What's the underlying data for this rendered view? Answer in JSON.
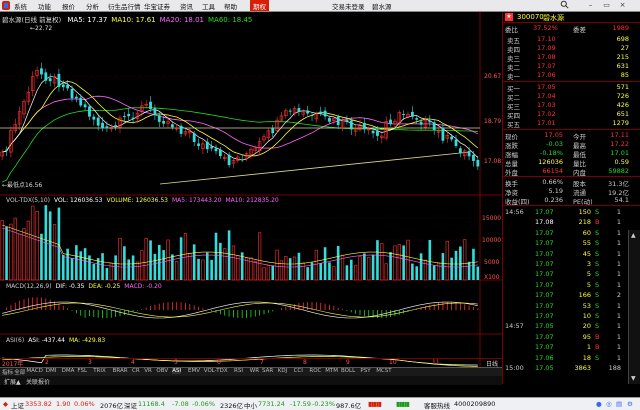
{
  "menubar": {
    "items": [
      "系统",
      "功能",
      "报价",
      "分析",
      "衍生品行情",
      "华宝证券",
      "资讯",
      "工具",
      "帮助"
    ],
    "trade": "期权",
    "center": [
      "交易未登录",
      "碧水源"
    ],
    "icons": [
      "search-icon",
      "window-min-icon",
      "window-max-icon",
      "window-close-icon"
    ]
  },
  "chart": {
    "title_stock": "碧水源(日线 前复权)",
    "ma_labels": [
      {
        "t": "MA5: 17.37",
        "c": "#ffffff"
      },
      {
        "t": "MA10: 17.61",
        "c": "#ffff33"
      },
      {
        "t": "MA20: 18.01",
        "c": "#ff66ff"
      },
      {
        "t": "MA60: 18.45",
        "c": "#22dd22"
      }
    ],
    "price_ticks": [
      "20.67",
      "18.79",
      "17.08"
    ],
    "hi_label": "22.72",
    "lo_label": "最低点16.56",
    "vol_header": [
      {
        "t": "VOL-TDX(5,10)",
        "c": "#cccccc"
      },
      {
        "t": "VOL: 126036.53",
        "c": "#ffffff"
      },
      {
        "t": "VOLUME: 126036.53",
        "c": "#ffff33"
      },
      {
        "t": "MA5: 173443.20",
        "c": "#ff66ff"
      },
      {
        "t": "MA10: 212835.20",
        "c": "#ff66ff"
      }
    ],
    "vol_ticks": [
      "15000",
      "10000",
      "5000",
      "X100"
    ],
    "macd_header": [
      {
        "t": "MACD(12,26,9)",
        "c": "#cccccc"
      },
      {
        "t": "DIF: -0.35",
        "c": "#ffffff"
      },
      {
        "t": "DEA: -0.25",
        "c": "#ffff33"
      },
      {
        "t": "MACD: -0.20",
        "c": "#ff66ff"
      }
    ],
    "asi_header": [
      {
        "t": "ASI(6)",
        "c": "#cccccc"
      },
      {
        "t": "ASI: -437.44",
        "c": "#ffffff"
      },
      {
        "t": "MA: -429.83",
        "c": "#ffff33"
      }
    ],
    "date_labels": [
      "2017年",
      "2",
      "3",
      "4",
      "5",
      "6",
      "7",
      "8",
      "9",
      "10",
      "11"
    ],
    "date_right": "日线",
    "tabs": [
      "指标",
      "全部",
      "MACD",
      "DMI",
      "DMA",
      "FSL",
      "TRIX",
      "BRAR",
      "CR",
      "VR",
      "OBV",
      "ASI",
      "EMV",
      "VOL-TDX",
      "RSI",
      "WR",
      "SAR",
      "KDJ",
      "CCI",
      "ROC",
      "MTM",
      "BOLL",
      "PSY",
      "MCST"
    ],
    "ext_tabs": [
      "扩展▲",
      "关联报价"
    ]
  },
  "quote": {
    "code": "300070",
    "name": "碧水源",
    "webi_label": "委比",
    "webi": "37.52%",
    "weicha_label": "委差",
    "weicha": "1989",
    "sells": [
      {
        "l": "卖五",
        "p": "17.10",
        "v": "698"
      },
      {
        "l": "卖四",
        "p": "17.09",
        "v": "27"
      },
      {
        "l": "卖三",
        "p": "17.08",
        "v": "215"
      },
      {
        "l": "卖二",
        "p": "17.07",
        "v": "631"
      },
      {
        "l": "卖一",
        "p": "17.06",
        "v": "85"
      }
    ],
    "buys": [
      {
        "l": "买一",
        "p": "17.05",
        "v": "571"
      },
      {
        "l": "买二",
        "p": "17.04",
        "v": "726"
      },
      {
        "l": "买三",
        "p": "17.03",
        "v": "426"
      },
      {
        "l": "买四",
        "p": "17.02",
        "v": "651"
      },
      {
        "l": "买五",
        "p": "17.01",
        "v": "1279"
      }
    ],
    "stats": [
      [
        "现价",
        "17.05",
        "今开",
        "17.11"
      ],
      [
        "涨跌",
        "-0.03",
        "最高",
        "17.22"
      ],
      [
        "涨幅",
        "-0.18%",
        "最低",
        "17.01"
      ],
      [
        "总量",
        "126036",
        "量比",
        "0.59"
      ],
      [
        "外盘",
        "66154",
        "内盘",
        "59882"
      ],
      [
        "换手",
        "0.66%",
        "股本",
        "31.3亿"
      ],
      [
        "净资",
        "5.19",
        "流通",
        "19.2亿"
      ],
      [
        "收益(四)",
        "0.236",
        "PE(动)",
        "54.1"
      ]
    ],
    "ticks": [
      [
        "14:56",
        "17.07",
        "150",
        "S",
        "1"
      ],
      [
        "",
        "17.08",
        "218",
        "B",
        "1"
      ],
      [
        "",
        "17.07",
        "60",
        "S",
        "1"
      ],
      [
        "",
        "17.07",
        "55",
        "S",
        "1"
      ],
      [
        "",
        "17.07",
        "45",
        "S",
        "1"
      ],
      [
        "",
        "17.07",
        "3",
        "S",
        "1"
      ],
      [
        "",
        "17.07",
        "5",
        "S",
        "1"
      ],
      [
        "",
        "17.07",
        "5",
        "S",
        "1"
      ],
      [
        "",
        "17.07",
        "166",
        "S",
        "2"
      ],
      [
        "",
        "17.07",
        "53",
        "S",
        "1"
      ],
      [
        "",
        "17.07",
        "10",
        "S",
        "1"
      ],
      [
        "14:57",
        "17.05",
        "20",
        "S",
        "1"
      ],
      [
        "",
        "17.07",
        "95",
        "B",
        "1"
      ],
      [
        "",
        "17.07",
        "1",
        "B",
        "1"
      ],
      [
        "",
        "17.06",
        "18",
        "S",
        "1"
      ],
      [
        "15:00",
        "17.05",
        "3863",
        "",
        "188"
      ]
    ]
  },
  "status": {
    "sh_label": "上证",
    "sh": "3353.82",
    "sh_chg": "1.90",
    "sh_pct": "0.06%",
    "sh_amt": "2076亿",
    "sz_label": "深证",
    "sz": "11168.4",
    "sz_chg": "-7.08",
    "sz_pct": "-0.06%",
    "sz_amt": "2326亿",
    "zx_label": "中小",
    "zx": "7731.24",
    "zx_chg": "-17.59",
    "zx_pct": "-0.23%",
    "zx_amt": "987.6亿",
    "hot": "客服热线",
    "phone": "4000209890"
  },
  "colors": {
    "up": "#ff3333",
    "down": "#22dd22",
    "panel_border": "#7a0000"
  }
}
